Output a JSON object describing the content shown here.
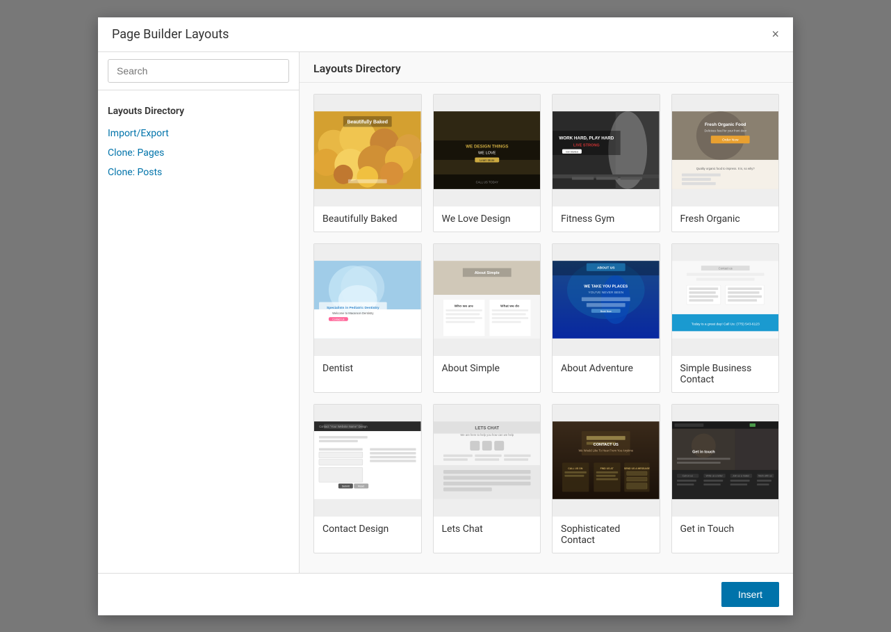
{
  "modal": {
    "title": "Page Builder Layouts",
    "close_label": "×"
  },
  "search": {
    "placeholder": "Search",
    "value": ""
  },
  "sidebar": {
    "section_title": "Layouts Directory",
    "links": [
      {
        "id": "import-export",
        "label": "Import/Export"
      },
      {
        "id": "clone-pages",
        "label": "Clone: Pages"
      },
      {
        "id": "clone-posts",
        "label": "Clone: Posts"
      }
    ]
  },
  "content": {
    "header": "Layouts Directory",
    "layouts": [
      {
        "id": "beautifully-baked",
        "label": "Beautifully Baked",
        "thumb_type": "baked"
      },
      {
        "id": "we-love-design",
        "label": "We Love Design",
        "thumb_type": "design"
      },
      {
        "id": "fitness-gym",
        "label": "Fitness Gym",
        "thumb_type": "fitness"
      },
      {
        "id": "fresh-organic",
        "label": "Fresh Organic",
        "thumb_type": "organic"
      },
      {
        "id": "dentist",
        "label": "Dentist",
        "thumb_type": "dentist"
      },
      {
        "id": "about-simple",
        "label": "About Simple",
        "thumb_type": "about-simple"
      },
      {
        "id": "about-adventure",
        "label": "About Adventure",
        "thumb_type": "about-adventure"
      },
      {
        "id": "simple-business-contact",
        "label": "Simple Business Contact",
        "thumb_type": "simple-contact"
      },
      {
        "id": "contact-design",
        "label": "Contact Design",
        "thumb_type": "contact-design"
      },
      {
        "id": "lets-chat",
        "label": "Lets Chat",
        "thumb_type": "lets-chat"
      },
      {
        "id": "sophisticated-contact",
        "label": "Sophisticated Contact",
        "thumb_type": "sophisticated"
      },
      {
        "id": "get-in-touch",
        "label": "Get in Touch",
        "thumb_type": "get-in-touch"
      }
    ]
  },
  "footer": {
    "insert_label": "Insert"
  }
}
